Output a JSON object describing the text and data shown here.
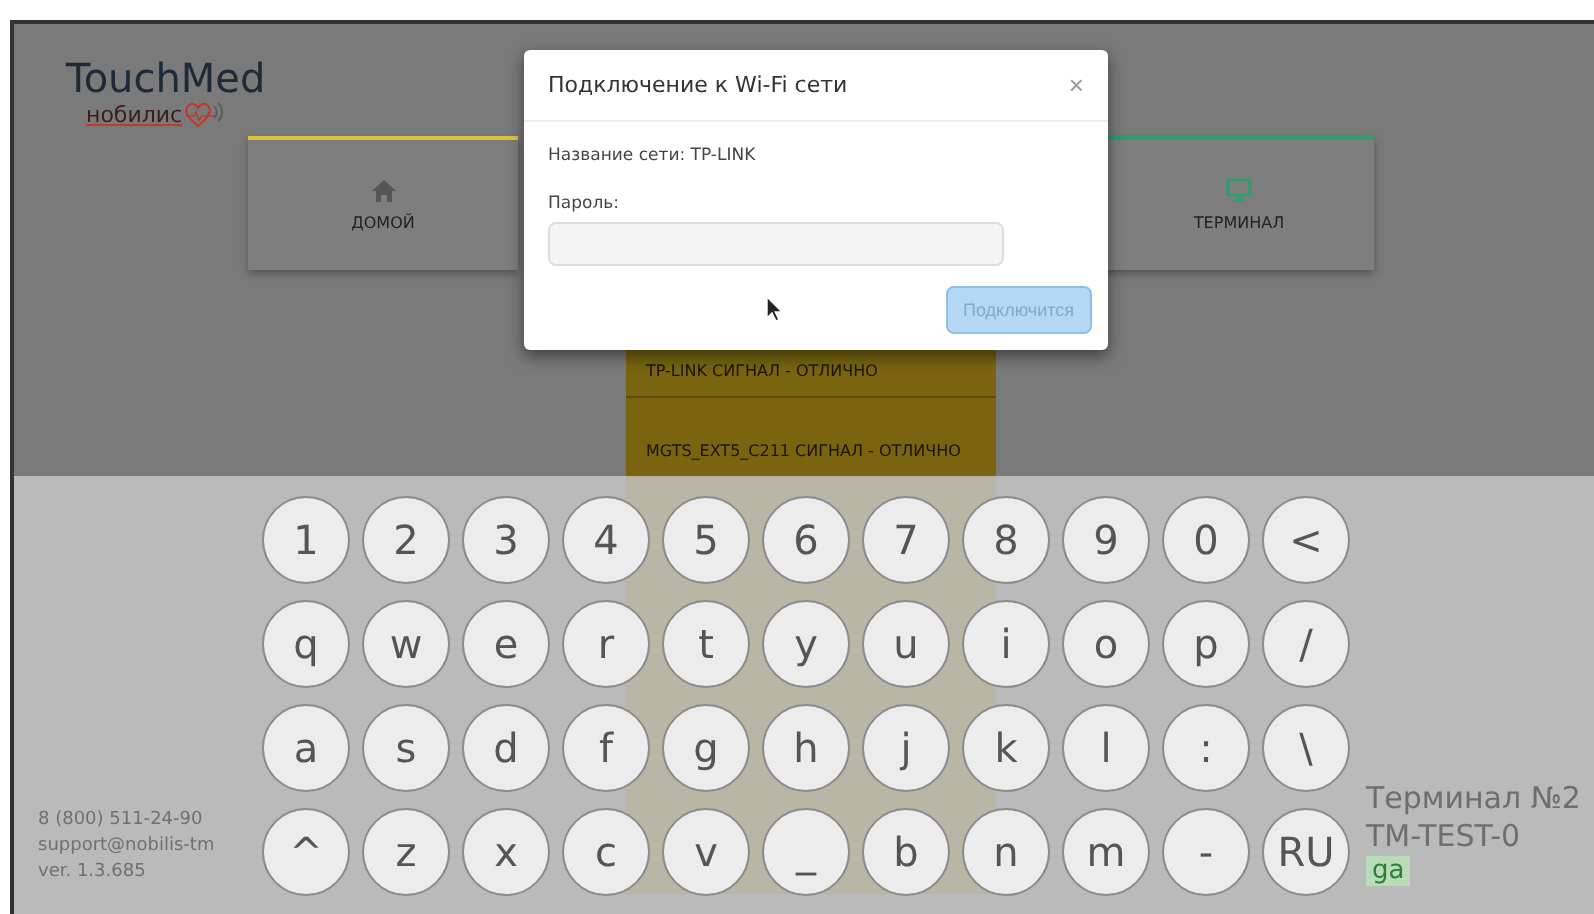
{
  "screen": {
    "logo": {
      "title": "TouchMed",
      "subtitle": "нобилис"
    },
    "nav_cards": [
      {
        "label": "ДОМОЙ",
        "kind": "home",
        "color": "#e0c040"
      },
      {
        "label": "ТЕРМИНАЛ",
        "kind": "monitor",
        "color": "#2e9e6e"
      }
    ],
    "wifi_networks": [
      {
        "label": "TP-LINK СИГНАЛ - ОТЛИЧНО"
      },
      {
        "label": "MGTS_EXT5_C211 СИГНАЛ - ОТЛИЧНО"
      }
    ],
    "contacts": [
      "8 (800) 511-24-90",
      "support@nobilis-tm",
      "ver. 1.3.685"
    ],
    "terminal_info": [
      {
        "value": "Терминал №2",
        "kind": "text"
      },
      {
        "value": "TM-TEST-0",
        "kind": "text"
      },
      {
        "value": "ga",
        "kind": "status"
      }
    ]
  },
  "dialog": {
    "title": "Подключение к Wi-Fi сети",
    "close": "×",
    "network": "Название сети: TP-LINK",
    "password_label": "Пароль:",
    "button": {
      "label": "Подключится",
      "disabled": true
    }
  },
  "keyboard": {
    "rows": [
      [
        "1",
        "2",
        "3",
        "4",
        "5",
        "6",
        "7",
        "8",
        "9",
        "0",
        "<"
      ],
      [
        "q",
        "w",
        "e",
        "r",
        "t",
        "y",
        "u",
        "i",
        "o",
        "p",
        "/"
      ],
      [
        "a",
        "s",
        "d",
        "f",
        "g",
        "h",
        "j",
        "k",
        "l",
        ":",
        "\\"
      ],
      [
        "^",
        "z",
        "x",
        "c",
        "v",
        "_",
        "b",
        "n",
        "m",
        "-",
        "RU"
      ]
    ]
  }
}
